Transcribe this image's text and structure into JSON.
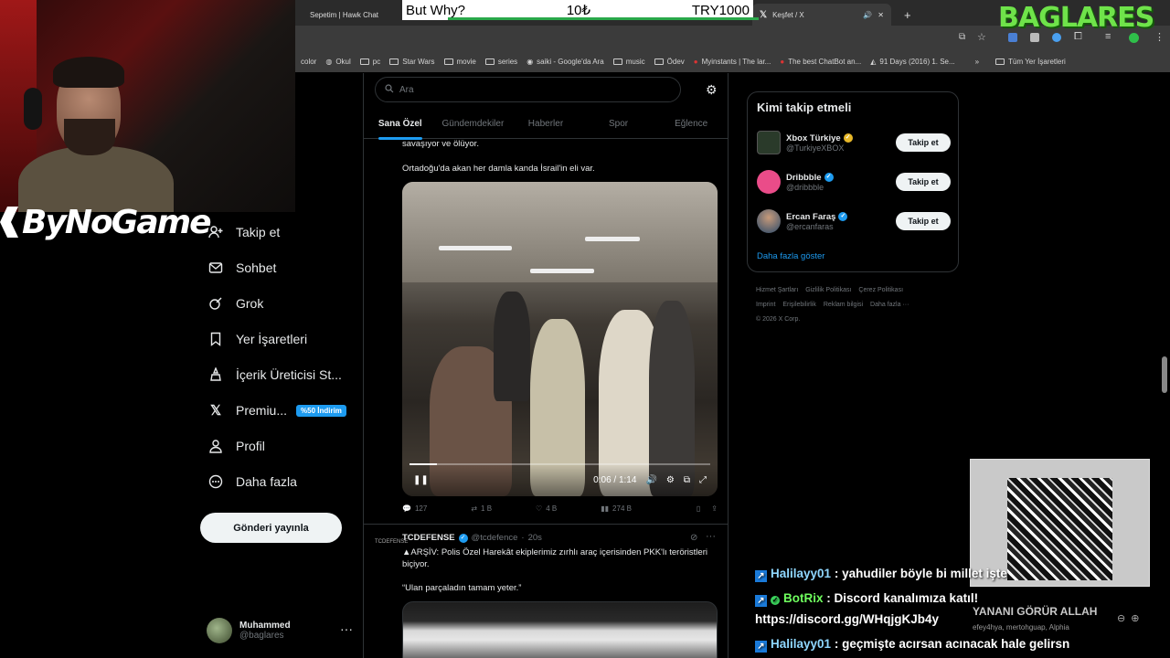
{
  "stream_overlay": {
    "donation_left": "But Why?",
    "donation_mid": "10₺",
    "donation_right": "TRY1000",
    "channel_logo": "BAGLARES",
    "sponsor_logo": "ByNoGame"
  },
  "browser": {
    "tabs": [
      {
        "label": "Sepetim | Hawk Chat"
      },
      {
        "label": "Keşfet / X"
      }
    ],
    "new_tab": "+",
    "bookmarks": [
      "color",
      "Okul",
      "pc",
      "Star Wars",
      "movie",
      "series",
      "saiki - Google'da Ara",
      "music",
      "Ödev",
      "Myinstants | The lar...",
      "The best ChatBot an...",
      "91 Days (2016) 1. Se..."
    ],
    "bookmarks_more": "»",
    "all_bookmarks": "Tüm Yer İşaretleri"
  },
  "sidebar": {
    "items": [
      {
        "label": "Takip et",
        "icon": "add-user-icon"
      },
      {
        "label": "Sohbet",
        "icon": "mail-icon"
      },
      {
        "label": "Grok",
        "icon": "grok-icon"
      },
      {
        "label": "Yer İşaretleri",
        "icon": "bookmark-icon"
      },
      {
        "label": "İçerik Üreticisi St...",
        "icon": "creator-icon"
      },
      {
        "label": "Premiu...",
        "icon": "x-logo-icon",
        "badge": "%50 İndirim"
      },
      {
        "label": "Profil",
        "icon": "profile-icon"
      },
      {
        "label": "Daha fazla",
        "icon": "more-circle-icon"
      }
    ],
    "post_button": "Gönderi yayınla",
    "user": {
      "name": "Muhammed",
      "handle": "@baglares",
      "more": "···"
    }
  },
  "main": {
    "search_placeholder": "Ara",
    "tabs": [
      "Sana Özel",
      "Gündemdekiler",
      "Haberler",
      "Spor",
      "Eğlence"
    ],
    "post1": {
      "text_top": "savaşıyor ve ölüyor.",
      "text": "Ortadoğu'da akan her damla kanda İsrail'in eli var.",
      "video_time": "0:06 / 1:14",
      "replies": "127",
      "reposts": "1 B",
      "likes": "4 B",
      "views": "274 B"
    },
    "post2": {
      "avatar_text": "TCDEFENSE",
      "name": "TCDEFENSE",
      "handle": "@tcdefence",
      "time": "20s",
      "more": "···",
      "text": "▲ARŞİV: Polis Özel Harekât ekiplerimiz zırhlı araç içerisinden PKK'lı teröristleri biçiyor.",
      "quote": "“Ulan parçaladın tamam yeter.”"
    }
  },
  "who_to_follow": {
    "title": "Kimi takip etmeli",
    "items": [
      {
        "name": "Xbox Türkiye",
        "handle": "@TurkiyeXBOX",
        "button": "Takip et"
      },
      {
        "name": "Dribbble",
        "handle": "@dribbble",
        "button": "Takip et"
      },
      {
        "name": "Ercan Faraş",
        "handle": "@ercanfaras",
        "button": "Takip et"
      }
    ],
    "show_more": "Daha fazla göster"
  },
  "footer": {
    "links": [
      "Hizmet Şartları",
      "Gizlilik Politikası",
      "Çerez Politikası",
      "Imprint",
      "Erişilebilirlik",
      "Reklam bilgisi",
      "Daha fazla ···"
    ],
    "copyright": "© 2026 X Corp."
  },
  "alert": {
    "title": "YANANI GÖRÜR ALLAH",
    "names": "efey4hya, mertohguap, Alphia"
  },
  "chat": [
    {
      "user": "Halilayy01",
      "message": ": yahudiler böyle bi millet işte"
    },
    {
      "user": "BotRix",
      "message": ": Discord kanalımıza katıl!",
      "message2": "https://discord.gg/WHqjgKJb4y"
    },
    {
      "user": "Halilayy01",
      "message": ": geçmişte acırsan acınacak hale gelirsn"
    }
  ],
  "colors": {
    "accent": "#1d9bf0",
    "bg": "#000000",
    "channel_logo": "#6fe34a",
    "botrix": "#6fff5e"
  }
}
